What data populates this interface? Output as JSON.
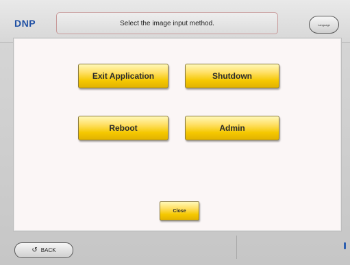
{
  "header": {
    "logo": "DNP",
    "instruction": "Select the image input method.",
    "language_label": "Language"
  },
  "dialog": {
    "buttons": {
      "exit_application": "Exit Application",
      "shutdown": "Shutdown",
      "reboot": "Reboot",
      "admin": "Admin",
      "close": "Close"
    }
  },
  "footer": {
    "back_label": "BACK",
    "back_icon": "rotate-left-icon"
  }
}
